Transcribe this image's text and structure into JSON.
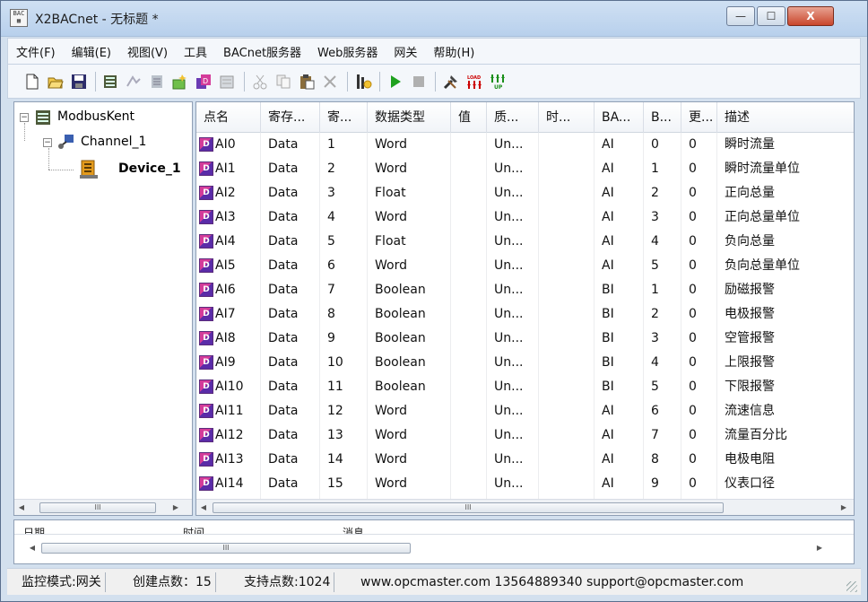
{
  "window": {
    "title": "X2BACnet - 无标题 *",
    "app_icon_text": "BAC",
    "controls": {
      "minimize": "—",
      "maximize": "☐",
      "close": "X"
    }
  },
  "menu": [
    "文件(F)",
    "编辑(E)",
    "视图(V)",
    "工具",
    "BACnet服务器",
    "Web服务器",
    "网关",
    "帮助(H)"
  ],
  "toolbar": {
    "buttons": [
      "new-icon",
      "open-icon",
      "save-icon",
      "add-channel-icon",
      "add-device-icon",
      "add-group-icon",
      "add-point-icon",
      "batch-add-icon",
      "properties-icon",
      "cut-icon",
      "copy-icon",
      "paste-icon",
      "delete-icon",
      "monitor-icon",
      "start-icon",
      "stop-icon",
      "tools-icon",
      "load-icon",
      "upload-icon"
    ],
    "load_text": "LOAD",
    "up_text": "UP"
  },
  "tree": {
    "root": {
      "label": "ModbusKent",
      "expander": "−"
    },
    "channel": {
      "label": "Channel_1",
      "expander": "−"
    },
    "device": {
      "label": "Device_1"
    },
    "scroll_thumb": "III"
  },
  "list": {
    "columns": [
      "点名",
      "寄存...",
      "寄...",
      "数据类型",
      "值",
      "质...",
      "时...",
      "BA...",
      "B...",
      "更...",
      "描述"
    ],
    "rows": [
      [
        "AI0",
        "Data",
        "1",
        "Word",
        "",
        "Un...",
        "",
        "AI",
        "0",
        "0",
        "瞬时流量"
      ],
      [
        "AI1",
        "Data",
        "2",
        "Word",
        "",
        "Un...",
        "",
        "AI",
        "1",
        "0",
        "瞬时流量单位"
      ],
      [
        "AI2",
        "Data",
        "3",
        "Float",
        "",
        "Un...",
        "",
        "AI",
        "2",
        "0",
        "正向总量"
      ],
      [
        "AI3",
        "Data",
        "4",
        "Word",
        "",
        "Un...",
        "",
        "AI",
        "3",
        "0",
        "正向总量单位"
      ],
      [
        "AI4",
        "Data",
        "5",
        "Float",
        "",
        "Un...",
        "",
        "AI",
        "4",
        "0",
        "负向总量"
      ],
      [
        "AI5",
        "Data",
        "6",
        "Word",
        "",
        "Un...",
        "",
        "AI",
        "5",
        "0",
        "负向总量单位"
      ],
      [
        "AI6",
        "Data",
        "7",
        "Boolean",
        "",
        "Un...",
        "",
        "BI",
        "1",
        "0",
        "励磁报警"
      ],
      [
        "AI7",
        "Data",
        "8",
        "Boolean",
        "",
        "Un...",
        "",
        "BI",
        "2",
        "0",
        "电极报警"
      ],
      [
        "AI8",
        "Data",
        "9",
        "Boolean",
        "",
        "Un...",
        "",
        "BI",
        "3",
        "0",
        "空管报警"
      ],
      [
        "AI9",
        "Data",
        "10",
        "Boolean",
        "",
        "Un...",
        "",
        "BI",
        "4",
        "0",
        "上限报警"
      ],
      [
        "AI10",
        "Data",
        "11",
        "Boolean",
        "",
        "Un...",
        "",
        "BI",
        "5",
        "0",
        "下限报警"
      ],
      [
        "AI11",
        "Data",
        "12",
        "Word",
        "",
        "Un...",
        "",
        "AI",
        "6",
        "0",
        "流速信息"
      ],
      [
        "AI12",
        "Data",
        "13",
        "Word",
        "",
        "Un...",
        "",
        "AI",
        "7",
        "0",
        "流量百分比"
      ],
      [
        "AI13",
        "Data",
        "14",
        "Word",
        "",
        "Un...",
        "",
        "AI",
        "8",
        "0",
        "电极电阻"
      ],
      [
        "AI14",
        "Data",
        "15",
        "Word",
        "",
        "Un...",
        "",
        "AI",
        "9",
        "0",
        "仪表口径"
      ]
    ],
    "point_icon_text": "D",
    "scroll_thumb": "III"
  },
  "log": {
    "columns": [
      "日期",
      "时间",
      "消息"
    ],
    "scroll_thumb": "III"
  },
  "status": {
    "mode": "监控模式:网关",
    "created": "创建点数：15",
    "supported": "支持点数:1024",
    "contact": "www.opcmaster.com 13564889340 support@opcmaster.com"
  }
}
